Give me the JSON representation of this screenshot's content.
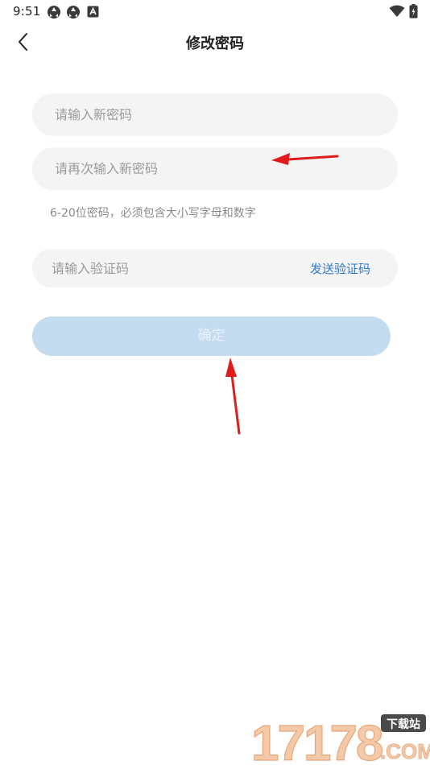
{
  "status_bar": {
    "time": "9:51",
    "left_icons": [
      "recycle-icon",
      "recycle-icon",
      "font-app-icon"
    ],
    "right_icons": [
      "wifi-icon",
      "battery-icon"
    ]
  },
  "header": {
    "title": "修改密码",
    "back_icon": "chevron-left-icon"
  },
  "form": {
    "new_password": {
      "placeholder": "请输入新密码",
      "value": ""
    },
    "confirm_password": {
      "placeholder": "请再次输入新密码",
      "value": ""
    },
    "hint": "6-20位密码，必须包含大小写字母和数字",
    "verification_code": {
      "placeholder": "请输入验证码",
      "value": ""
    },
    "send_code_label": "发送验证码",
    "confirm_label": "确定"
  },
  "annotations": {
    "arrow_color": "#e01b1b",
    "arrows": [
      "arrow-to-confirm-password",
      "arrow-to-confirm-button"
    ]
  },
  "watermark": {
    "number": "17178",
    "tag": "下载站",
    "suffix": ".COM"
  },
  "colors": {
    "accent": "#2a7bd5",
    "button_disabled": "#c3dcf0",
    "field_bg": "#f4f4f4"
  }
}
